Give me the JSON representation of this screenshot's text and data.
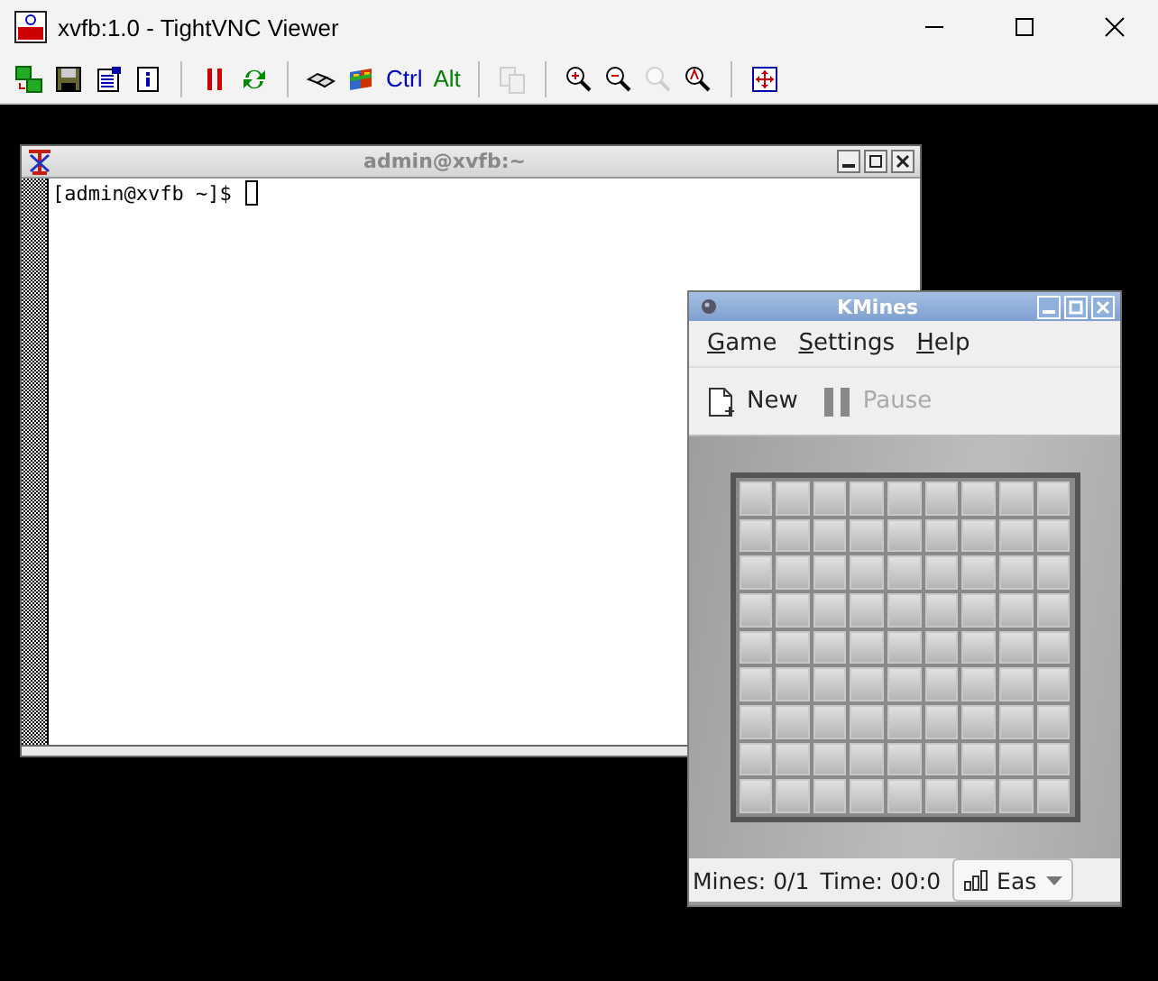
{
  "window": {
    "title": "xvfb:1.0 - TightVNC Viewer"
  },
  "toolbar": [
    {
      "kind": "icon",
      "disabled": false
    },
    {
      "kind": "icon",
      "disabled": false
    },
    {
      "kind": "icon",
      "disabled": false
    },
    {
      "kind": "icon",
      "disabled": false
    },
    {
      "kind": "separator"
    },
    {
      "kind": "icon",
      "disabled": false
    },
    {
      "kind": "icon",
      "disabled": false
    },
    {
      "kind": "separator"
    },
    {
      "kind": "icon",
      "disabled": false
    },
    {
      "kind": "icon",
      "disabled": false
    },
    {
      "kind": "text",
      "label": "Ctrl",
      "color": "#0000c0"
    },
    {
      "kind": "text",
      "label": "Alt",
      "color": "#008000"
    },
    {
      "kind": "separator"
    },
    {
      "kind": "icon",
      "disabled": true
    },
    {
      "kind": "separator"
    },
    {
      "kind": "icon",
      "disabled": false
    },
    {
      "kind": "icon",
      "disabled": false
    },
    {
      "kind": "icon",
      "disabled": true
    },
    {
      "kind": "icon",
      "disabled": false
    },
    {
      "kind": "separator"
    },
    {
      "kind": "icon",
      "disabled": false
    }
  ],
  "terminal": {
    "title": "admin@xvfb:~",
    "lines": [
      "[admin@xvfb ~]$ "
    ]
  },
  "kmines": {
    "title": "KMines",
    "menu": [
      "Game",
      "Settings",
      "Help"
    ],
    "toolbar": [
      {
        "kind": "new",
        "label": "New",
        "disabled": false
      },
      {
        "kind": "pause",
        "label": "Pause",
        "disabled": true
      }
    ],
    "status": {
      "mines": "Mines: 0/1",
      "time": "Time: 00:0",
      "difficulty": "Eas"
    }
  }
}
